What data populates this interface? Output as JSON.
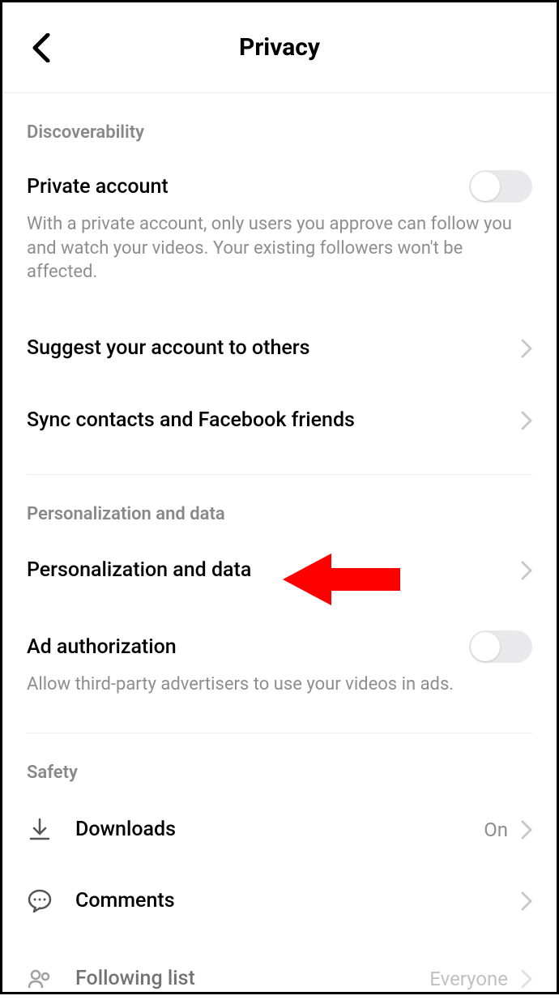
{
  "header": {
    "title": "Privacy"
  },
  "sections": {
    "discoverability": {
      "label": "Discoverability",
      "private_account": {
        "title": "Private account",
        "description": "With a private account, only users you approve can follow you and watch your videos. Your existing followers won't be affected."
      },
      "suggest": {
        "title": "Suggest your account to others"
      },
      "sync": {
        "title": "Sync contacts and Facebook friends"
      }
    },
    "personalization": {
      "label": "Personalization and data",
      "item": {
        "title": "Personalization and data"
      },
      "ad_auth": {
        "title": "Ad authorization",
        "description": "Allow third-party advertisers to use your videos in ads."
      }
    },
    "safety": {
      "label": "Safety",
      "downloads": {
        "title": "Downloads",
        "value": "On"
      },
      "comments": {
        "title": "Comments"
      },
      "following": {
        "title": "Following list",
        "value": "Everyone"
      }
    }
  }
}
